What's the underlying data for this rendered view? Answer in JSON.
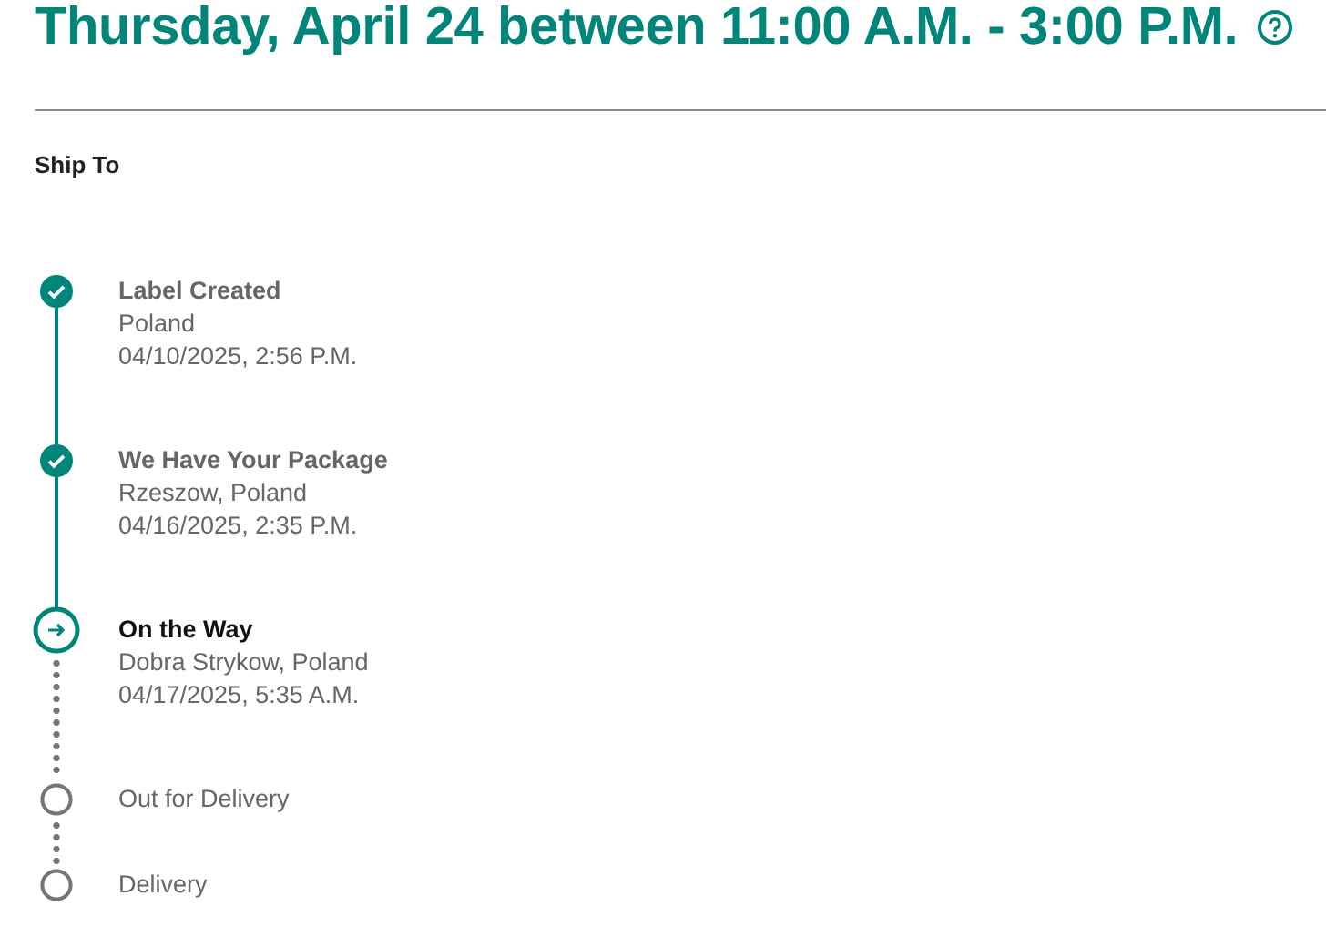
{
  "delivery_estimate": "Thursday, April 24 between 11:00 A.M. - 3:00 P.M.",
  "ship_to_label": "Ship To",
  "steps": [
    {
      "kind": "done",
      "title": "Label Created",
      "location": "Poland",
      "time": "04/10/2025, 2:56 P.M."
    },
    {
      "kind": "done",
      "title": "We Have Your Package",
      "location": "Rzeszow, Poland",
      "time": "04/16/2025, 2:35 P.M."
    },
    {
      "kind": "current",
      "title": "On the Way",
      "location": "Dobra Strykow, Poland",
      "time": "04/17/2025, 5:35 A.M."
    },
    {
      "kind": "pending",
      "title": "Out for Delivery"
    },
    {
      "kind": "pending",
      "title": "Delivery"
    }
  ]
}
